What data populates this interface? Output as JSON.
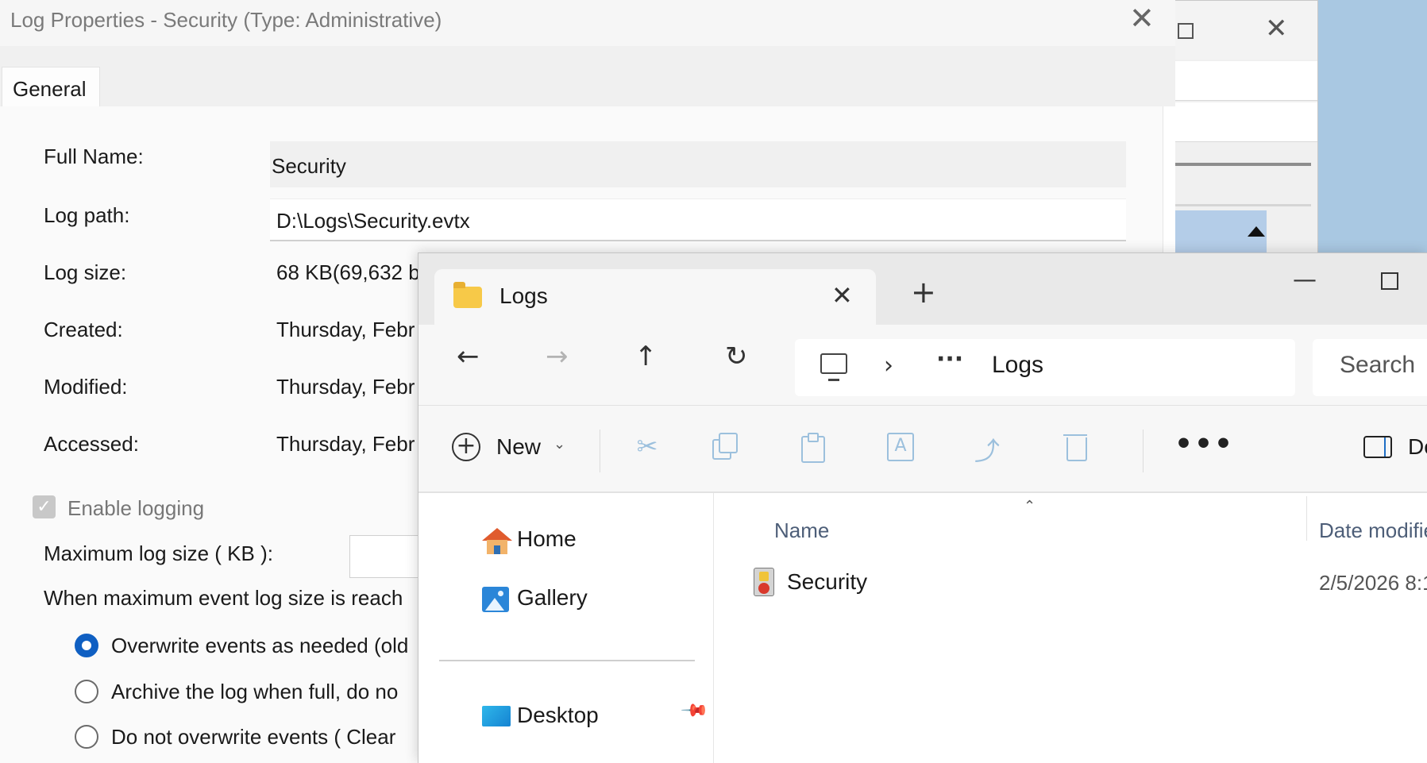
{
  "dialog": {
    "title": "Log Properties - Security (Type: Administrative)",
    "tab_general": "General",
    "full_name_label": "Full Name:",
    "full_name_value": "Security",
    "log_path_label": "Log path:",
    "log_path_value": "D:\\Logs\\Security.evtx",
    "log_size_label": "Log size:",
    "log_size_value": "68 KB(69,632 by",
    "created_label": "Created:",
    "created_value": "Thursday, Febr",
    "modified_label": "Modified:",
    "modified_value": "Thursday, Febr",
    "accessed_label": "Accessed:",
    "accessed_value": "Thursday, Febr",
    "enable_logging_label": "Enable logging",
    "enable_logging_checked": true,
    "max_log_size_label": "Maximum log size ( KB ):",
    "when_max_label": "When maximum event log size is reach",
    "radio_overwrite": "Overwrite events as needed (old",
    "radio_archive": "Archive the log when full, do no",
    "radio_donot": "Do not overwrite events ( Clear",
    "selected_radio": "overwrite"
  },
  "explorer": {
    "tab_title": "Logs",
    "address_current": "Logs",
    "search_placeholder": "Search",
    "toolbar": {
      "new_label": "New",
      "details_label": "De"
    },
    "nav_pane": [
      {
        "label": "Home",
        "icon": "home-icon"
      },
      {
        "label": "Gallery",
        "icon": "gallery-icon"
      },
      {
        "label": "Desktop",
        "icon": "desktop-icon"
      }
    ],
    "columns": {
      "name": "Name",
      "date_modified": "Date modifie"
    },
    "files": [
      {
        "name": "Security",
        "date": "2/5/2026 8:1"
      }
    ]
  },
  "colors": {
    "accent": "#0f5fc2",
    "disabled_icon": "#9cc0dd",
    "background_desktop": "#a9c8e2"
  }
}
